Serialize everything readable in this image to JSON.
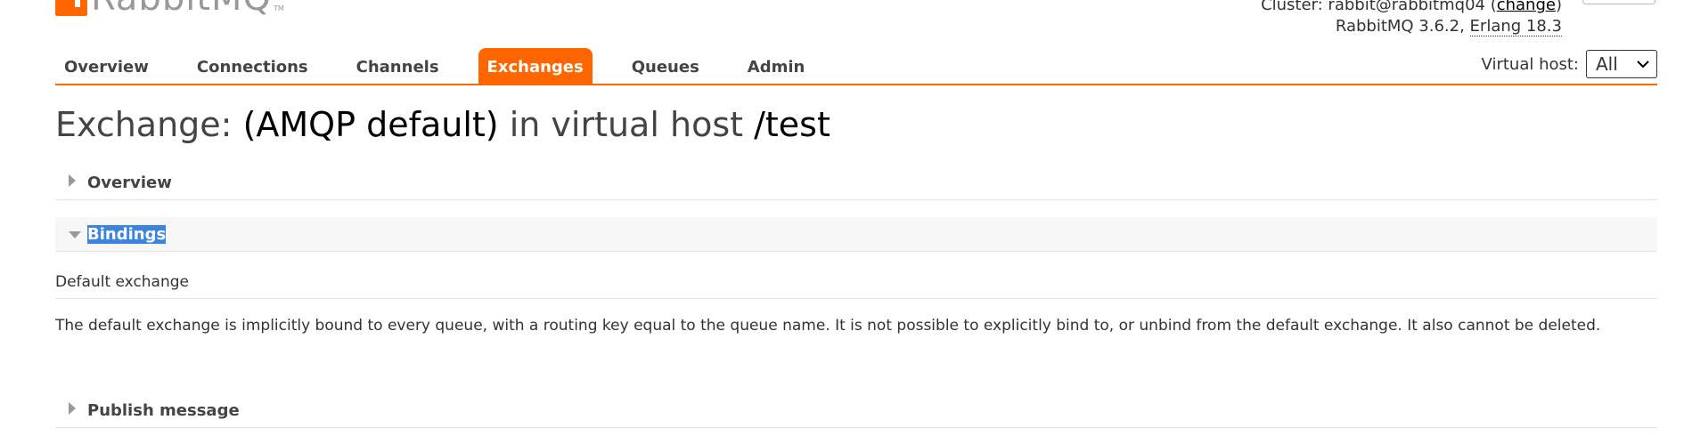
{
  "header": {
    "logo_name": "RabbitMQ",
    "cluster_prefix": "Cluster: ",
    "cluster_name": "rabbit@rabbitmq04",
    "change_link": "change",
    "version": "RabbitMQ 3.6.2, ",
    "erlang": "Erlang 18.3"
  },
  "nav": {
    "tabs": [
      {
        "label": "Overview"
      },
      {
        "label": "Connections"
      },
      {
        "label": "Channels"
      },
      {
        "label": "Exchanges",
        "active": true
      },
      {
        "label": "Queues"
      },
      {
        "label": "Admin"
      }
    ],
    "vhost_label": "Virtual host:",
    "vhost_value": "All"
  },
  "page": {
    "title_prefix": "Exchange: ",
    "exchange_name": "(AMQP default)",
    "title_middle": " in virtual host ",
    "vhost_name": "/test"
  },
  "sections": {
    "overview": {
      "label": "Overview"
    },
    "bindings": {
      "label": "Bindings",
      "sub_heading": "Default exchange",
      "description": "The default exchange is implicitly bound to every queue, with a routing key equal to the queue name. It is not possible to explicitly bind to, or unbind from the default exchange. It also cannot be deleted."
    },
    "publish": {
      "label": "Publish message"
    }
  },
  "colors": {
    "accent": "#ff6600",
    "selection": "#3b85e0"
  },
  "icons": {
    "collapsed": "triangle-right-icon",
    "expanded": "triangle-down-icon",
    "select": "chevron-down-icon"
  }
}
